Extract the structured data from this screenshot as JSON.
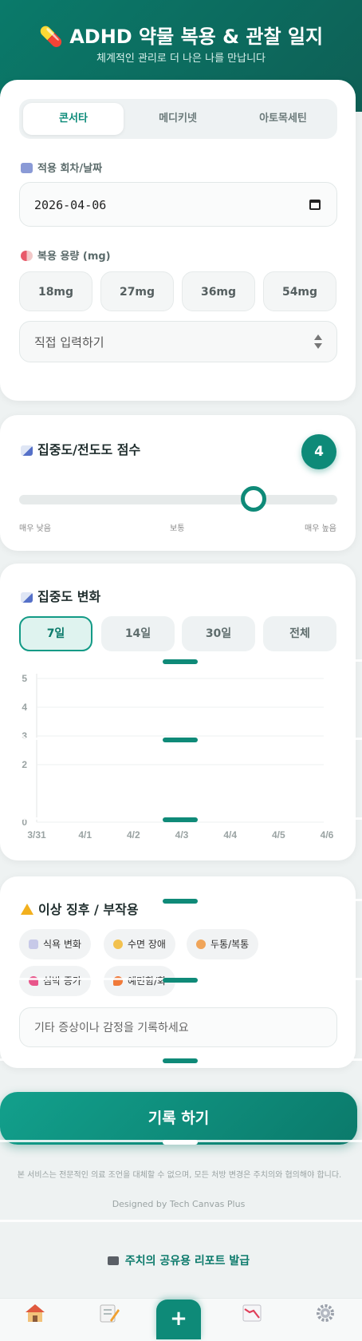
{
  "header": {
    "title": "💊 ADHD 약물 복용 & 관찰 일지",
    "subtitle": "체계적인 관리로 더 나은 나를 만납니다"
  },
  "med_tabs": [
    {
      "label": "콘서타",
      "active": true
    },
    {
      "label": "메디키넷",
      "active": false
    },
    {
      "label": "아토목세틴",
      "active": false
    }
  ],
  "date_section": {
    "label": "적용 회차/날짜",
    "value": "2026-04-06"
  },
  "dose_section": {
    "label": "복용 용량 (mg)",
    "options": [
      "18mg",
      "27mg",
      "36mg",
      "54mg"
    ],
    "custom_placeholder": "직접 입력하기"
  },
  "focus_score": {
    "title": "집중도/전도도 점수",
    "value": "4",
    "level": 0.75,
    "scale_low": "매우 낮음",
    "scale_mid": "보통",
    "scale_high": "매우 높음"
  },
  "trend": {
    "title": "집중도 변화",
    "ranges": [
      {
        "label": "7일",
        "active": true
      },
      {
        "label": "14일",
        "active": false
      },
      {
        "label": "30일",
        "active": false
      },
      {
        "label": "전체",
        "active": false
      }
    ]
  },
  "chart_data": {
    "type": "line",
    "title": "",
    "xlabel": "",
    "ylabel": "",
    "categories": [
      "3/31",
      "4/1",
      "4/2",
      "4/3",
      "4/4",
      "4/5",
      "4/6"
    ],
    "series": [],
    "yticks": [
      "0",
      "2",
      "3",
      "4",
      "5"
    ],
    "ylim": [
      0,
      5
    ],
    "grid": true
  },
  "side_effects": {
    "title": "이상 징후 / 부작용",
    "chips": [
      {
        "label": "식욕 변화",
        "icon": "utensils-icon",
        "color": "#c7c9e8"
      },
      {
        "label": "수면 장애",
        "icon": "moon-icon",
        "color": "#f2c14e"
      },
      {
        "label": "두통/복통",
        "icon": "sick-face-icon",
        "color": "#f0a55a"
      },
      {
        "label": "심박 증가",
        "icon": "heart-icon",
        "color": "#e8558a"
      },
      {
        "label": "예민함/화",
        "icon": "fire-icon",
        "color": "#f07a3a"
      }
    ],
    "note_placeholder": "기타 증상이나 감정을 기록하세요"
  },
  "submit_label": "기록 하기",
  "footer": {
    "disclaimer": "본 서비스는 전문적인 의료 조언을 대체할 수 없으며, 모든 처방 변경은 주치의와 협의해야 합니다.",
    "credit": "Designed by Tech Canvas Plus"
  },
  "report_button": "주치의 공유용 리포트 발급",
  "nav": [
    {
      "icon": "home-icon"
    },
    {
      "icon": "memo-icon"
    },
    {
      "icon": "plus-icon",
      "label": "+"
    },
    {
      "icon": "chart-down-icon"
    },
    {
      "icon": "gear-icon"
    }
  ],
  "colors": {
    "primary": "#0a7a6a",
    "accent": "#139a86",
    "background": "#eef2f2"
  }
}
